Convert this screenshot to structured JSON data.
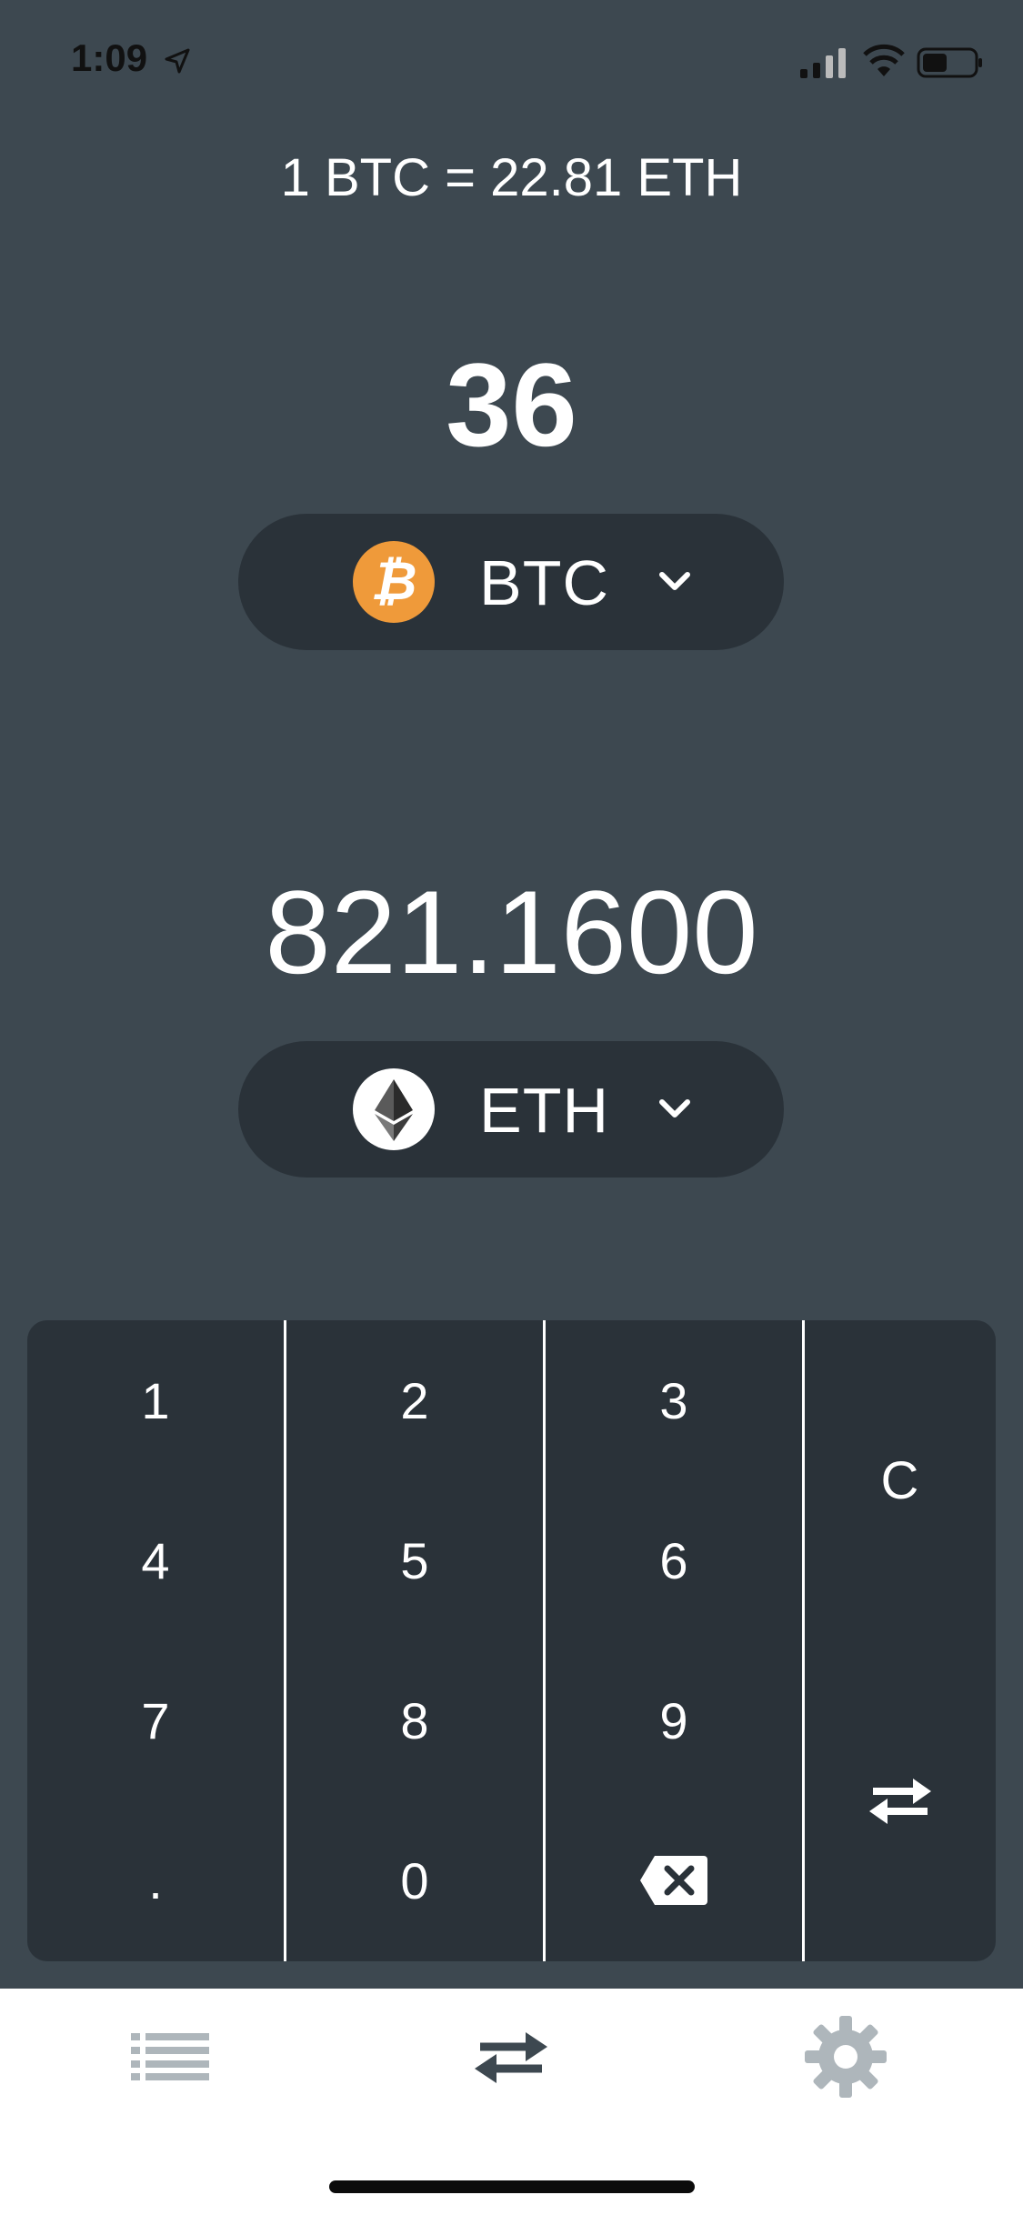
{
  "status_bar": {
    "time": "1:09"
  },
  "rate_text": "1 BTC = 22.81 ETH",
  "from": {
    "amount": "36",
    "currency": "BTC",
    "icon": "bitcoin-icon",
    "color": "#ef9a3a"
  },
  "to": {
    "amount": "821.1600",
    "currency": "ETH",
    "icon": "ethereum-icon"
  },
  "keypad": {
    "keys": [
      "1",
      "2",
      "3",
      "4",
      "5",
      "6",
      "7",
      "8",
      "9",
      ".",
      "0"
    ],
    "clear": "C",
    "backspace_icon": "backspace-icon",
    "swap_icon": "swap-icon"
  },
  "tabs": [
    {
      "icon": "list-icon",
      "active": false
    },
    {
      "icon": "swap-icon",
      "active": true
    },
    {
      "icon": "gear-icon",
      "active": false
    }
  ],
  "colors": {
    "background": "#3d4850",
    "panel": "#2a3239",
    "inactive_tab": "#aeb6bb",
    "active_tab": "#3d4850"
  }
}
